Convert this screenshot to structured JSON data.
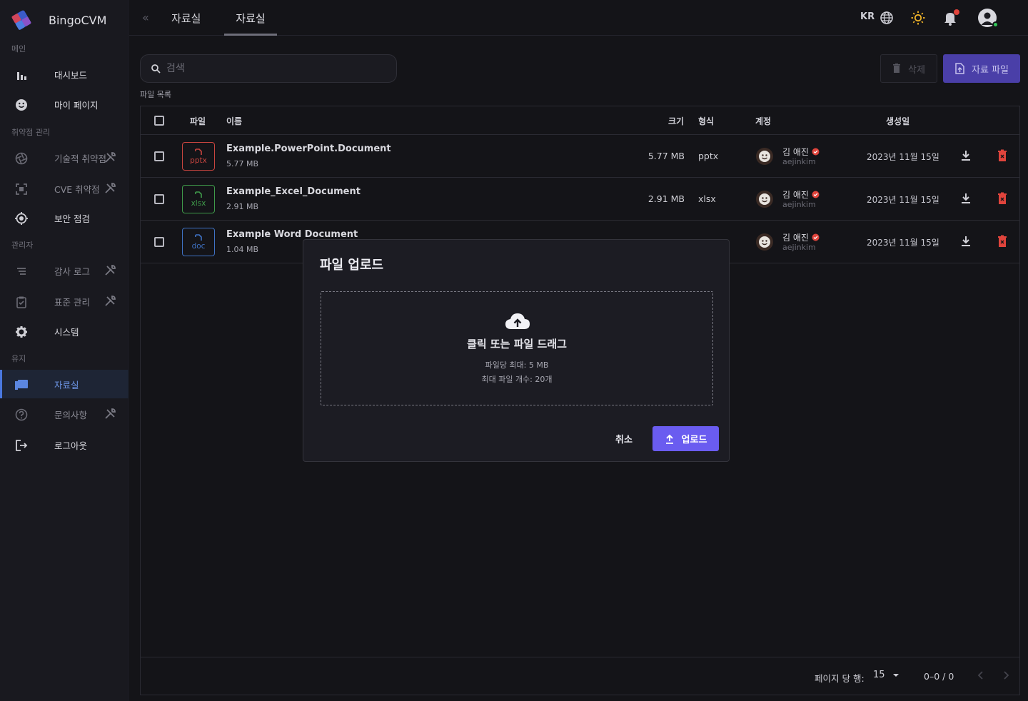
{
  "app": {
    "name": "BingoCVM"
  },
  "colors": {
    "accent": "#6a5cf0",
    "primary_button": "#4a3fa8",
    "danger": "#e0443c",
    "active_nav": "#6f98ea"
  },
  "sidebar": {
    "sections": {
      "main": "메인",
      "vuln": "취약점 관리",
      "admin": "관리자",
      "maintenance": "유지"
    },
    "items": [
      {
        "label": "대시보드",
        "icon": "bar-chart-icon"
      },
      {
        "label": "마이 페이지",
        "icon": "smiley-icon"
      },
      {
        "label": "기술적 취약점",
        "icon": "aperture-icon",
        "tool": true
      },
      {
        "label": "CVE 취약점",
        "icon": "scan-icon",
        "tool": true
      },
      {
        "label": "보안 점검",
        "icon": "target-icon"
      },
      {
        "label": "감사 로그",
        "icon": "list-icon",
        "tool": true
      },
      {
        "label": "표준 관리",
        "icon": "clipboard-check-icon",
        "tool": true
      },
      {
        "label": "시스템",
        "icon": "gear-icon"
      },
      {
        "label": "자료실",
        "icon": "folder-icon",
        "active": true
      },
      {
        "label": "문의사항",
        "icon": "question-icon",
        "tool": true
      },
      {
        "label": "로그아웃",
        "icon": "logout-icon"
      }
    ]
  },
  "topbar": {
    "tabs": [
      "자료실",
      "자료실"
    ],
    "active_tab": 1,
    "language": "KR"
  },
  "search": {
    "placeholder": "검색",
    "value": ""
  },
  "toolbar": {
    "delete_label": "삭제",
    "file_label": "자료 파일"
  },
  "list_label": "파일 목록",
  "table": {
    "headers": {
      "file": "파일",
      "name": "이름",
      "size": "크기",
      "format": "형식",
      "account": "계정",
      "created": "생성일"
    },
    "rows": [
      {
        "ext": "pptx",
        "ext_color": "#c8453f",
        "name": "Example.PowerPoint.Document",
        "sub": "5.77 MB",
        "size": "5.77 MB",
        "format": "pptx",
        "account_name": "김 애진",
        "account_id": "aejinkim",
        "date": "2023년 11월 15일"
      },
      {
        "ext": "xlsx",
        "ext_color": "#3f9a4a",
        "name": "Example_Excel_Document",
        "sub": "2.91 MB",
        "size": "2.91 MB",
        "format": "xlsx",
        "account_name": "김 애진",
        "account_id": "aejinkim",
        "date": "2023년 11월 15일"
      },
      {
        "ext": "doc",
        "ext_color": "#3f72c4",
        "name": "Example Word Document",
        "sub": "1.04 MB",
        "size": "",
        "format": "",
        "account_name": "김 애진",
        "account_id": "aejinkim",
        "date": "2023년 11월 15일"
      }
    ],
    "footer": {
      "rows_per_page_label": "페이지 당 행:",
      "rows_per_page": "15",
      "range": "0–0 / 0"
    }
  },
  "modal": {
    "title": "파일 업로드",
    "drop_main": "클릭 또는 파일 드래그",
    "drop_limit_size": "파일당 최대: 5 MB",
    "drop_limit_count": "최대 파일 개수: 20개",
    "cancel_label": "취소",
    "upload_label": "업로드"
  }
}
